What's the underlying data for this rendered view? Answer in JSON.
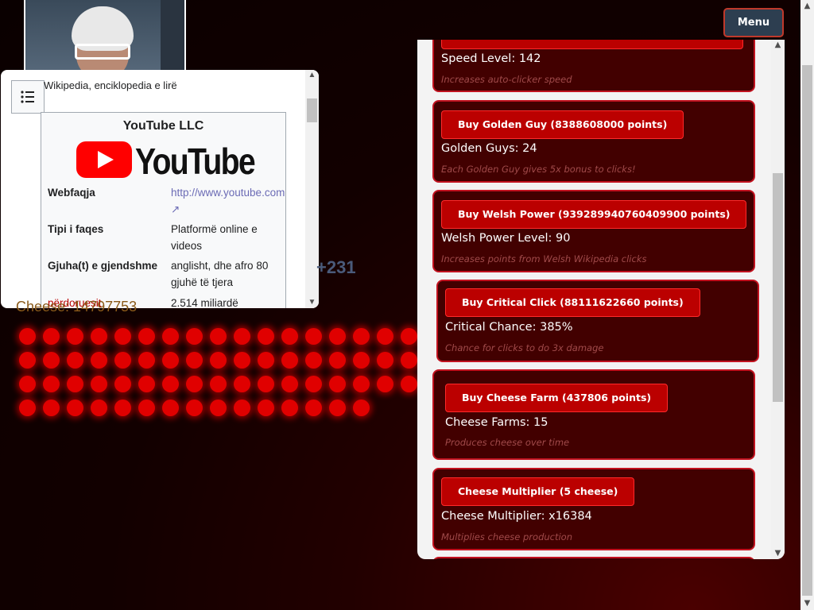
{
  "menu": {
    "label": "Menu"
  },
  "wiki": {
    "subtitle": "Wikipedia, enciklopedia e lirë",
    "infobox_title": "YouTube LLC",
    "logo_text": "YouTube",
    "rows": [
      {
        "key": "Webfaqja",
        "value": "http://www.youtube.com"
      },
      {
        "key": "Tipi i faqes",
        "value": "Platformë online e videos"
      },
      {
        "key": "Gjuha(t) e gjendshme",
        "value": "anglisht, dhe afro 80 gjuhë të tjera"
      },
      {
        "key": "përdoruesit",
        "value": "2.514 miliardë"
      }
    ]
  },
  "game": {
    "floating_bonus": "+231",
    "cheese_label": "Cheese: 14797753"
  },
  "shop": {
    "top_card": {
      "stat": "Speed Level: 142",
      "desc": "Increases auto-clicker speed"
    },
    "cards": [
      {
        "button": "Buy Golden Guy (8388608000 points)",
        "stat": "Golden Guys: 24",
        "desc": "Each Golden Guy gives 5x bonus to clicks!"
      },
      {
        "button": "Buy Welsh Power (939289940760409900 points)",
        "stat": "Welsh Power Level: 90",
        "desc": "Increases points from Welsh Wikipedia clicks"
      },
      {
        "button": "Buy Critical Click (88111622660 points)",
        "stat": "Critical Chance: 385%",
        "desc": "Chance for clicks to do 3x damage"
      },
      {
        "button": "Buy Cheese Farm (437806 points)",
        "stat": "Cheese Farms: 15",
        "desc": "Produces cheese over time"
      },
      {
        "button": "Cheese Multiplier (5 cheese)",
        "stat": "Cheese Multiplier: x16384",
        "desc": "Multiplies cheese production"
      }
    ]
  },
  "colors": {
    "accent": "#c1121f",
    "card_bg": "#420000",
    "button_bg": "#bb0000"
  }
}
